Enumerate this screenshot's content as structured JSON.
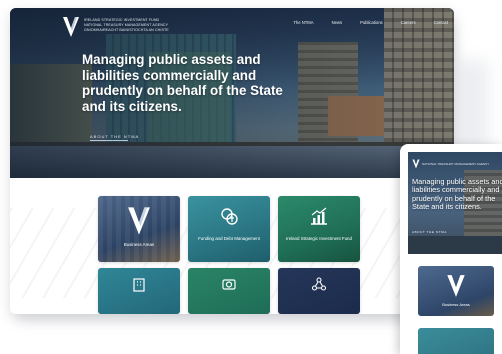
{
  "desktop": {
    "org_name_lines": [
      "IRELAND STRATEGIC INVESTMENT FUND",
      "NATIONAL TREASURY MANAGEMENT AGENCY",
      "GNIOMHAIREACHT BAINISTIOCHTA AN CHISTE"
    ],
    "nav": {
      "items": [
        "The NTMA",
        "News",
        "Publications",
        "Careers",
        "Contact"
      ]
    },
    "hero": {
      "headline": "Managing public assets and liabilities commercially and prudently on behalf of the State and its citizens.",
      "about_link": "ABOUT THE NTMA"
    },
    "tiles": [
      {
        "label": "Business Areas",
        "color": "#344b6b",
        "icon": "logo-icon"
      },
      {
        "label": "Funding and Debt Management",
        "color": "#2e7e8c",
        "icon": "money-icon"
      },
      {
        "label": "Ireland Strategic Investment Fund",
        "color": "#1f6e56",
        "icon": "growth-chart-icon"
      },
      {
        "label": "",
        "color": "#23677a",
        "icon": "building-icon"
      },
      {
        "label": "",
        "color": "#1e6d56",
        "icon": "camera-icon"
      },
      {
        "label": "",
        "color": "#1c2b4a",
        "icon": "network-icon"
      }
    ]
  },
  "mobile": {
    "headline": "Managing public assets and liabilities commercially and prudently on behalf of the State and its citizens.",
    "tiles": [
      {
        "label": "Business Areas",
        "color": "#3b5678"
      },
      {
        "label": "",
        "color": "#2f7483"
      }
    ]
  },
  "colors": {
    "hero_overlay": "#1a2d45",
    "accent_teal": "#2e7e8c",
    "accent_green": "#1f6e56",
    "dark_navy": "#1c2b4a"
  }
}
